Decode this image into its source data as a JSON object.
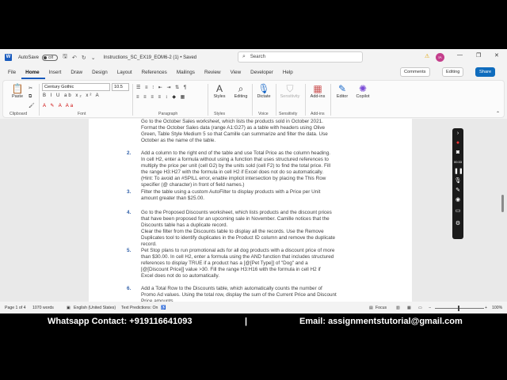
{
  "titlebar": {
    "autosave_label": "AutoSave",
    "autosave_state": "Off",
    "doc_title": "Instructions_SC_EX19_EOM6-2 (1) • Saved",
    "search_placeholder": "Search",
    "avatar_initials": "IA",
    "minimize": "—",
    "restore": "❐",
    "close": "✕"
  },
  "menu": {
    "tabs": [
      "File",
      "Home",
      "Insert",
      "Draw",
      "Design",
      "Layout",
      "References",
      "Mailings",
      "Review",
      "View",
      "Developer",
      "Help"
    ],
    "active": "Home",
    "comments": "Comments",
    "editing": "Editing",
    "share": "Share"
  },
  "ribbon": {
    "paste": "Paste",
    "font_name": "Century Gothic",
    "font_size": "10.5",
    "styles": "Styles",
    "editing": "Editing",
    "dictate": "Dictate",
    "sensitivity": "Sensitivity",
    "addins": "Add-ins",
    "editor": "Editor",
    "copilot": "Copilot",
    "groups": {
      "clipboard": "Clipboard",
      "font": "Font",
      "paragraph": "Paragraph",
      "styles": "Styles",
      "voice": "Voice",
      "sensitivity": "Sensitivity",
      "addins": "Add-ins"
    }
  },
  "document": {
    "items": [
      {
        "num": "",
        "lines": [
          "Go to the October Sales worksheet, which lists the products sold in October 2021.",
          "Format the October Sales data (range A1:G27) as a table with headers using Olive",
          "Green, Table Style Medium 5 so that Camille can summarize and filter the data. Use",
          "October as the name of the table."
        ]
      },
      {
        "num": "2.",
        "lines": [
          "Add a column to the right end of the table and use Total Price as the column heading.",
          "In cell H2, enter a formula without using a function that uses structured references to",
          "multiply the price per unit (cell G2) by the units sold (cell F2) to find the total price. Fill",
          "the range H3:H27 with the formula in cell H2 if Excel does not do so automatically.",
          "(Hint: To avoid an #SPILL error, enable implicit intersection by placing the This Row",
          "specifier (@ character) in front of field names.)"
        ]
      },
      {
        "num": "3.",
        "lines": [
          "Filter the table using a custom AutoFilter to display products with a Price per Unit",
          "amount greater than $25.00."
        ]
      },
      {
        "num": "4.",
        "lines": [
          "Go to the Proposed Discounts worksheet, which lists products and the discount prices",
          "that have been proposed for an upcoming sale in November. Camille notices that the",
          "Discounts table has a duplicate record.",
          "Clear the filter from the Discounts table to display all the records. Use the Remove",
          "Duplicates tool to identify duplicates in the Product ID column and remove the duplicate",
          "record."
        ]
      },
      {
        "num": "5.",
        "lines": [
          "Pet Stop plans to run promotional ads for all dog products with a discount price of more",
          "than $30.00. In cell H2, enter a formula using the AND function that includes structured",
          "references to display TRUE if a product has a [@[Pet Type]] of \"Dog\" and a",
          "[@[Discount Price]] value >30. Fill the range H3:H16 with the formula in cell H2 if",
          "Excel does not do so automatically."
        ]
      },
      {
        "num": "6.",
        "lines": [
          "Add a Total Row to the Discounts table, which automatically counts the number of",
          "Promo Ad values. Using the total row, display the sum of the Current Price and Discount",
          "Price amounts."
        ]
      }
    ]
  },
  "statusbar": {
    "page": "Page 1 of 4",
    "words": "1070 words",
    "language": "English (United States)",
    "text_predictions": "Text Predictions: On",
    "focus": "Focus",
    "zoom": "100%"
  },
  "recorder": {
    "timer": "00:33"
  },
  "banner": {
    "left": "Whatsapp Contact: +919116641093",
    "divider": "|",
    "right": "Email: assignmentstutorial@gmail.com"
  },
  "colors": {
    "accent": "#185abd",
    "share": "#0f6cbd",
    "list_number": "#2e5ea8"
  }
}
